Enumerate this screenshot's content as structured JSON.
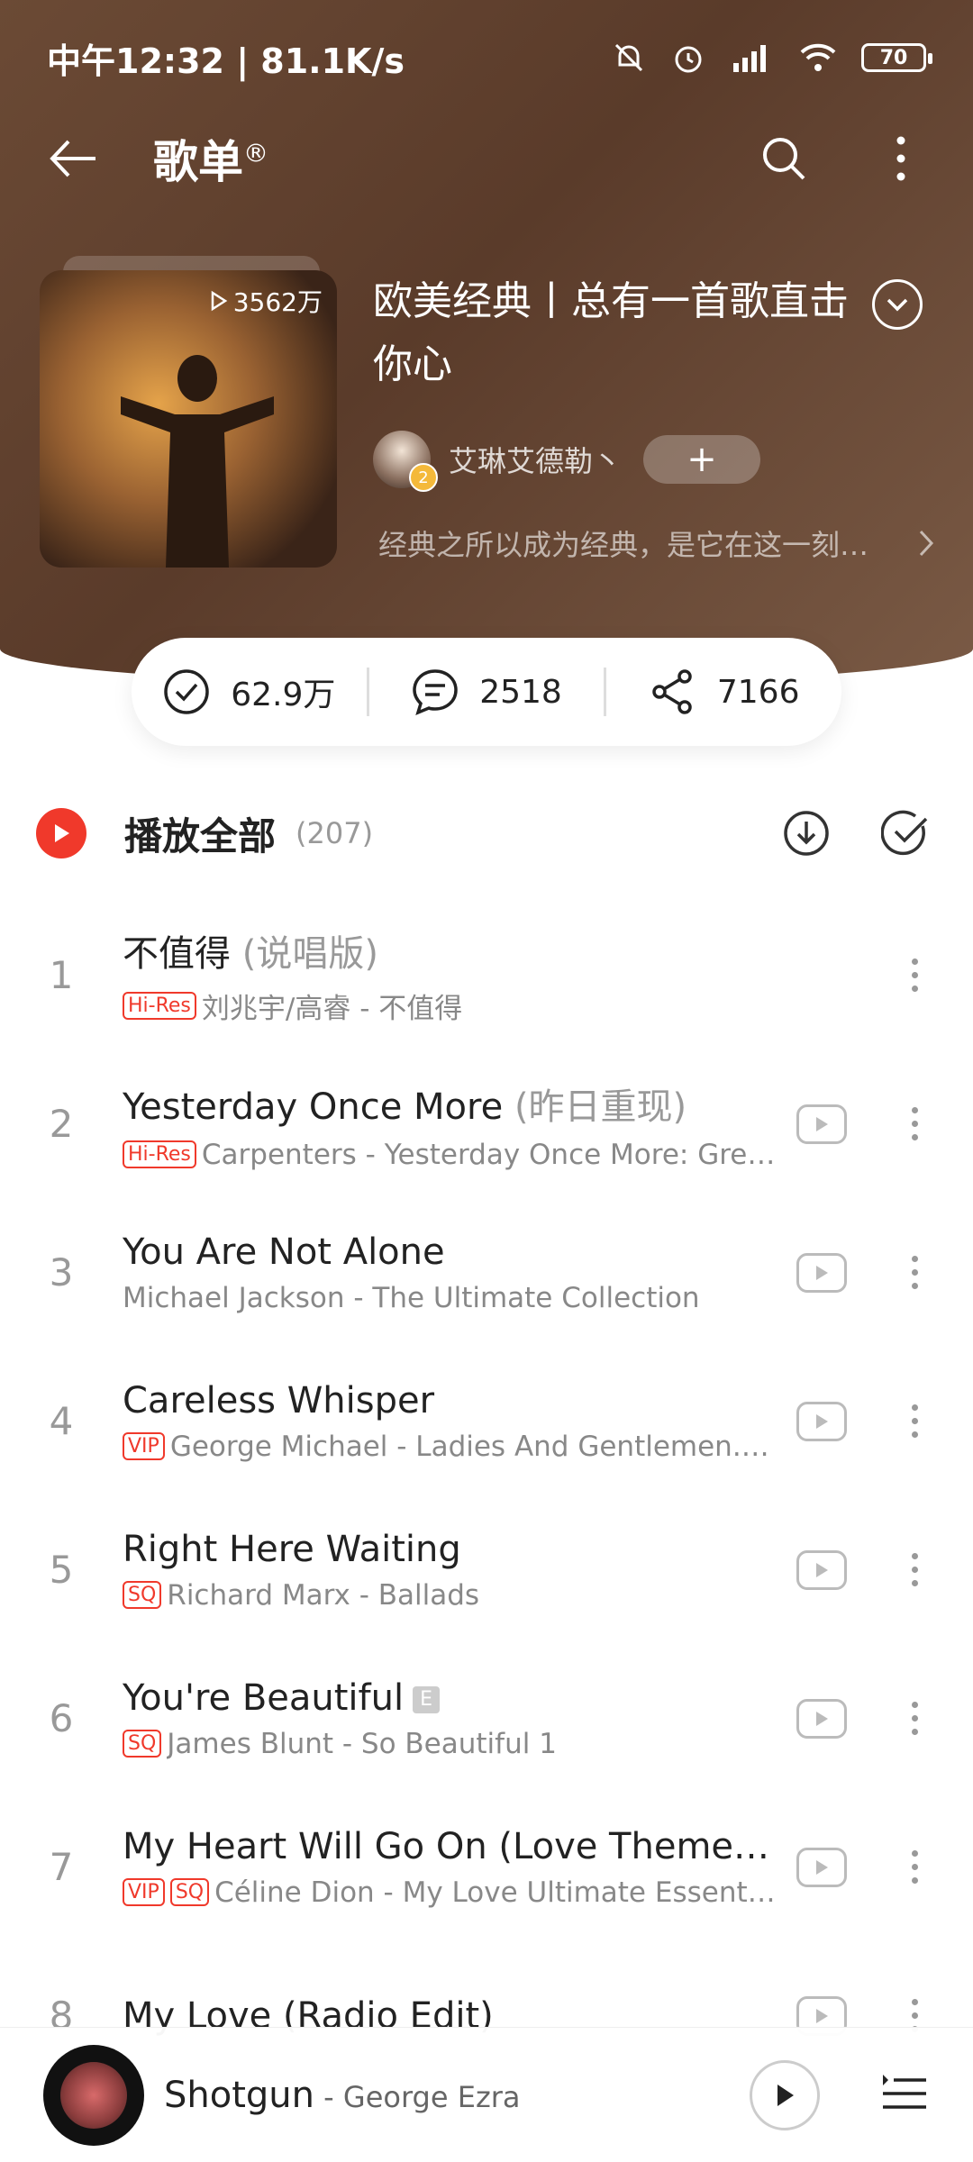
{
  "status_bar": {
    "time_speed": "中午12:32 | 81.1K/s",
    "battery": "70"
  },
  "nav": {
    "title": "歌单",
    "title_mark": "®"
  },
  "playlist": {
    "play_count": "3562万",
    "title": "欧美经典丨总有一首歌直击你心",
    "creator": "艾琳艾德勒丶",
    "creator_level": "2",
    "follow": "+",
    "description": "经典之所以成为经典，是它在这一刻…"
  },
  "actions": {
    "collect": "62.9万",
    "comments": "2518",
    "share": "7166"
  },
  "play_all": {
    "label": "播放全部",
    "count": "(207)"
  },
  "songs": [
    {
      "num": "1",
      "title": "不值得",
      "subtitle": "(说唱版)",
      "tags": [
        "Hi-Res"
      ],
      "meta": "刘兆宇/高睿 - 不值得",
      "mv": false,
      "explicit": ""
    },
    {
      "num": "2",
      "title": "Yesterday Once More",
      "subtitle": "(昨日重现)",
      "tags": [
        "Hi-Res"
      ],
      "meta": "Carpenters - Yesterday Once More: Gre…",
      "mv": true,
      "explicit": ""
    },
    {
      "num": "3",
      "title": "You Are Not Alone",
      "subtitle": "",
      "tags": [],
      "meta": "Michael Jackson - The Ultimate Collection",
      "mv": true,
      "explicit": ""
    },
    {
      "num": "4",
      "title": "Careless Whisper",
      "subtitle": "",
      "tags": [
        "VIP"
      ],
      "meta": "George Michael - Ladies And Gentlemen..…",
      "mv": true,
      "explicit": ""
    },
    {
      "num": "5",
      "title": "Right Here Waiting",
      "subtitle": "",
      "tags": [
        "SQ"
      ],
      "meta": "Richard Marx - Ballads",
      "mv": true,
      "explicit": ""
    },
    {
      "num": "6",
      "title": "You're Beautiful",
      "subtitle": "",
      "tags": [
        "SQ"
      ],
      "meta": "James Blunt - So Beautiful 1",
      "mv": true,
      "explicit": "E"
    },
    {
      "num": "7",
      "title": "My Heart Will Go On (Love Theme f…",
      "subtitle": "",
      "tags": [
        "VIP",
        "SQ"
      ],
      "meta": "Céline Dion - My Love Ultimate Essent…",
      "mv": true,
      "explicit": ""
    },
    {
      "num": "8",
      "title": "My Love (Radio Edit)",
      "subtitle": "",
      "tags": [],
      "meta": "",
      "mv": true,
      "explicit": ""
    }
  ],
  "mini_player": {
    "title": "Shotgun",
    "artist": " - George Ezra"
  },
  "colors": {
    "accent": "#f0392b",
    "hero": "#6b4a35"
  }
}
